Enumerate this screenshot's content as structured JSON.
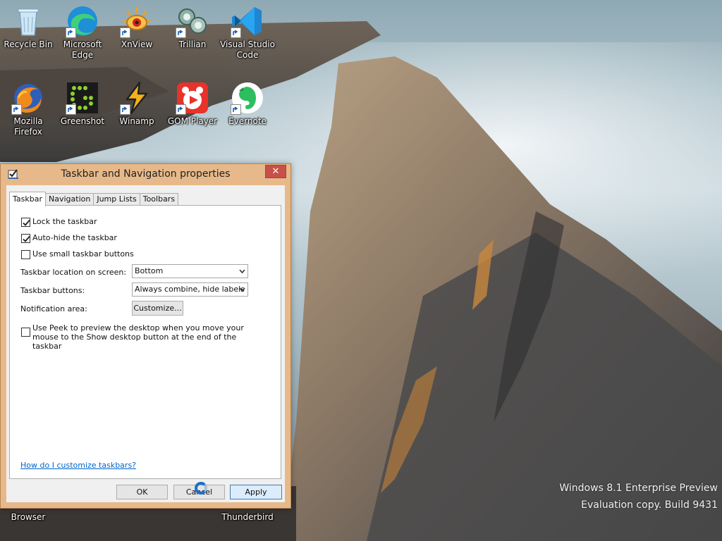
{
  "desktop": {
    "icons": [
      {
        "label": "Recycle Bin",
        "icon": "recycle-bin-icon"
      },
      {
        "label": "Microsoft Edge",
        "icon": "edge-icon"
      },
      {
        "label": "XnView",
        "icon": "xnview-icon"
      },
      {
        "label": "Trillian",
        "icon": "trillian-icon"
      },
      {
        "label": "Visual Studio Code",
        "icon": "vscode-icon"
      },
      {
        "label": "Mozilla Firefox",
        "icon": "firefox-icon"
      },
      {
        "label": "Greenshot",
        "icon": "greenshot-icon"
      },
      {
        "label": "Winamp",
        "icon": "winamp-icon"
      },
      {
        "label": "GOM Player",
        "icon": "gom-player-icon"
      },
      {
        "label": "Evernote",
        "icon": "evernote-icon"
      },
      {
        "label": "Browser",
        "icon": "browser-icon"
      },
      {
        "label": "Thunderbird",
        "icon": "thunderbird-icon"
      }
    ],
    "watermark_line1": "Windows 8.1 Enterprise Preview",
    "watermark_line2": "Evaluation copy. Build 9431"
  },
  "dialog": {
    "title": "Taskbar and Navigation properties",
    "close_label": "✕",
    "tabs": [
      {
        "label": "Taskbar",
        "active": true
      },
      {
        "label": "Navigation",
        "active": false
      },
      {
        "label": "Jump Lists",
        "active": false
      },
      {
        "label": "Toolbars",
        "active": false
      }
    ],
    "options": {
      "lock_taskbar": {
        "label": "Lock the taskbar",
        "checked": true
      },
      "auto_hide": {
        "label": "Auto-hide the taskbar",
        "checked": true
      },
      "small_buttons": {
        "label": "Use small taskbar buttons",
        "checked": false
      },
      "peek": {
        "label": "Use Peek to preview the desktop when you move your mouse to the Show desktop button at the end of the taskbar",
        "checked": false
      }
    },
    "location": {
      "label": "Taskbar location on screen:",
      "value": "Bottom"
    },
    "buttons_combine": {
      "label": "Taskbar buttons:",
      "value": "Always combine, hide labels"
    },
    "notification": {
      "label": "Notification area:",
      "button": "Customize..."
    },
    "help_link": "How do I customize taskbars?",
    "ok": "OK",
    "cancel": "Cancel",
    "apply": "Apply"
  },
  "colors": {
    "dialog_frame": "#e7b98a",
    "close_button": "#c7504b",
    "link": "#0066cc",
    "default_button_border": "#3c7fb1"
  }
}
